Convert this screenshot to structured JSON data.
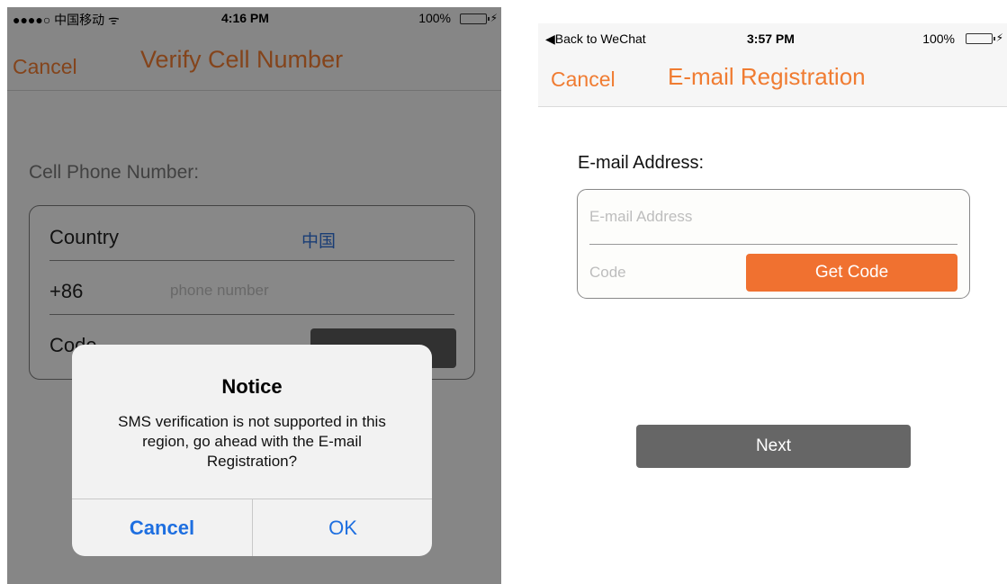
{
  "left_screen": {
    "status_bar": {
      "carrier": "●●●●○ 中国移动 ᯤ",
      "time": "4:16 PM",
      "battery": "100%"
    },
    "navbar": {
      "cancel_label": "Cancel",
      "title": "Verify Cell Number"
    },
    "form": {
      "section_label": "Cell Phone Number:",
      "country_label": "Country",
      "country_value": "中国",
      "dial_code": "+86",
      "phone_placeholder": "phone number",
      "code_label": "Code"
    },
    "alert": {
      "title": "Notice",
      "message": "SMS verification is not supported in this region,  go ahead with the E-mail Registration?",
      "cancel_label": "Cancel",
      "ok_label": "OK"
    }
  },
  "right_screen": {
    "status_bar": {
      "back_label": "◀Back to WeChat",
      "time": "3:57 PM",
      "battery": "100%"
    },
    "navbar": {
      "cancel_label": "Cancel",
      "title": "E-mail Registration"
    },
    "form": {
      "section_label": "E-mail Address:",
      "email_placeholder": "E-mail Address",
      "code_placeholder": "Code",
      "get_code_label": "Get Code"
    },
    "next_label": "Next"
  },
  "colors": {
    "accent_orange": "#f07c32",
    "alert_blue": "#1e6fe0",
    "battery_green": "#4cd964"
  }
}
